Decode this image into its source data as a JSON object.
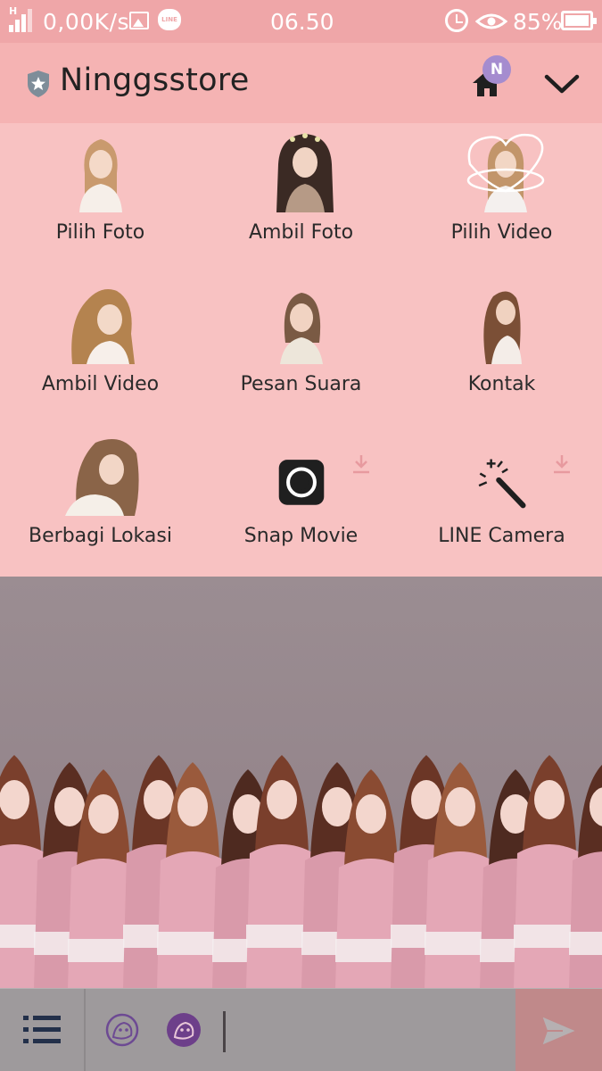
{
  "status_bar": {
    "network_speed": "0,00K/s",
    "signal_type": "H",
    "line_app_label": "LINE",
    "time": "06.50",
    "battery_percent": "85%",
    "battery_level": 0.85
  },
  "header": {
    "title": "Ninggsstore",
    "badge_letter": "N"
  },
  "attachments": [
    {
      "label": "Pilih Foto"
    },
    {
      "label": "Ambil Foto"
    },
    {
      "label": "Pilih Video"
    },
    {
      "label": "Ambil Video"
    },
    {
      "label": "Pesan Suara"
    },
    {
      "label": "Kontak"
    },
    {
      "label": "Berbagi Lokasi"
    },
    {
      "label": "Snap Movie"
    },
    {
      "label": "LINE Camera"
    }
  ],
  "colors": {
    "status_bar": "#efa6a8",
    "header": "#f5b3b3",
    "grid": "#f8c2c2",
    "badge": "#a58ccf",
    "input_bar": "#9e9a9c",
    "send_button": "#c0898a"
  }
}
